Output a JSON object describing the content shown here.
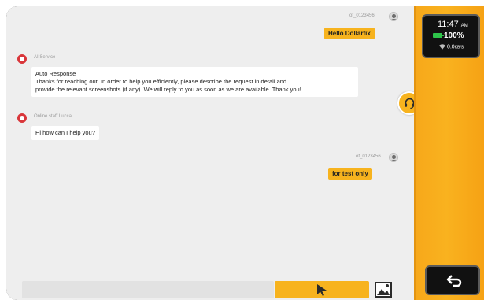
{
  "messages": [
    {
      "sender": "of_0123456",
      "text": "Hello Dollarfix",
      "side": "right"
    },
    {
      "sender": "AI Service",
      "title": "Auto Response",
      "lines": [
        "Thanks for reaching out. In order to help you efficiently, please describe the request in detail and",
        "provide the relevant screenshots (if any). We will reply to you as soon as we are available. Thank you!"
      ],
      "side": "left"
    },
    {
      "sender": "Online staff Lucca",
      "text": "Hi how can I help you?",
      "side": "left"
    },
    {
      "sender": "of_0123456",
      "text": "for test only",
      "side": "right"
    }
  ],
  "status": {
    "time": "11:47",
    "ampm": "AM",
    "battery": "100%",
    "network": "0.0",
    "network_unit": "KB/S"
  },
  "icons": {
    "support": "headset-icon",
    "send": "send-arrow-icon",
    "image": "image-icon",
    "back": "back-arrow-icon"
  },
  "colors": {
    "accent": "#f7b31e",
    "side_panel": "#f9b21f",
    "chat_bg": "#eeeeee",
    "avatar_red": "#d9363a",
    "battery": "#2ec44a"
  }
}
